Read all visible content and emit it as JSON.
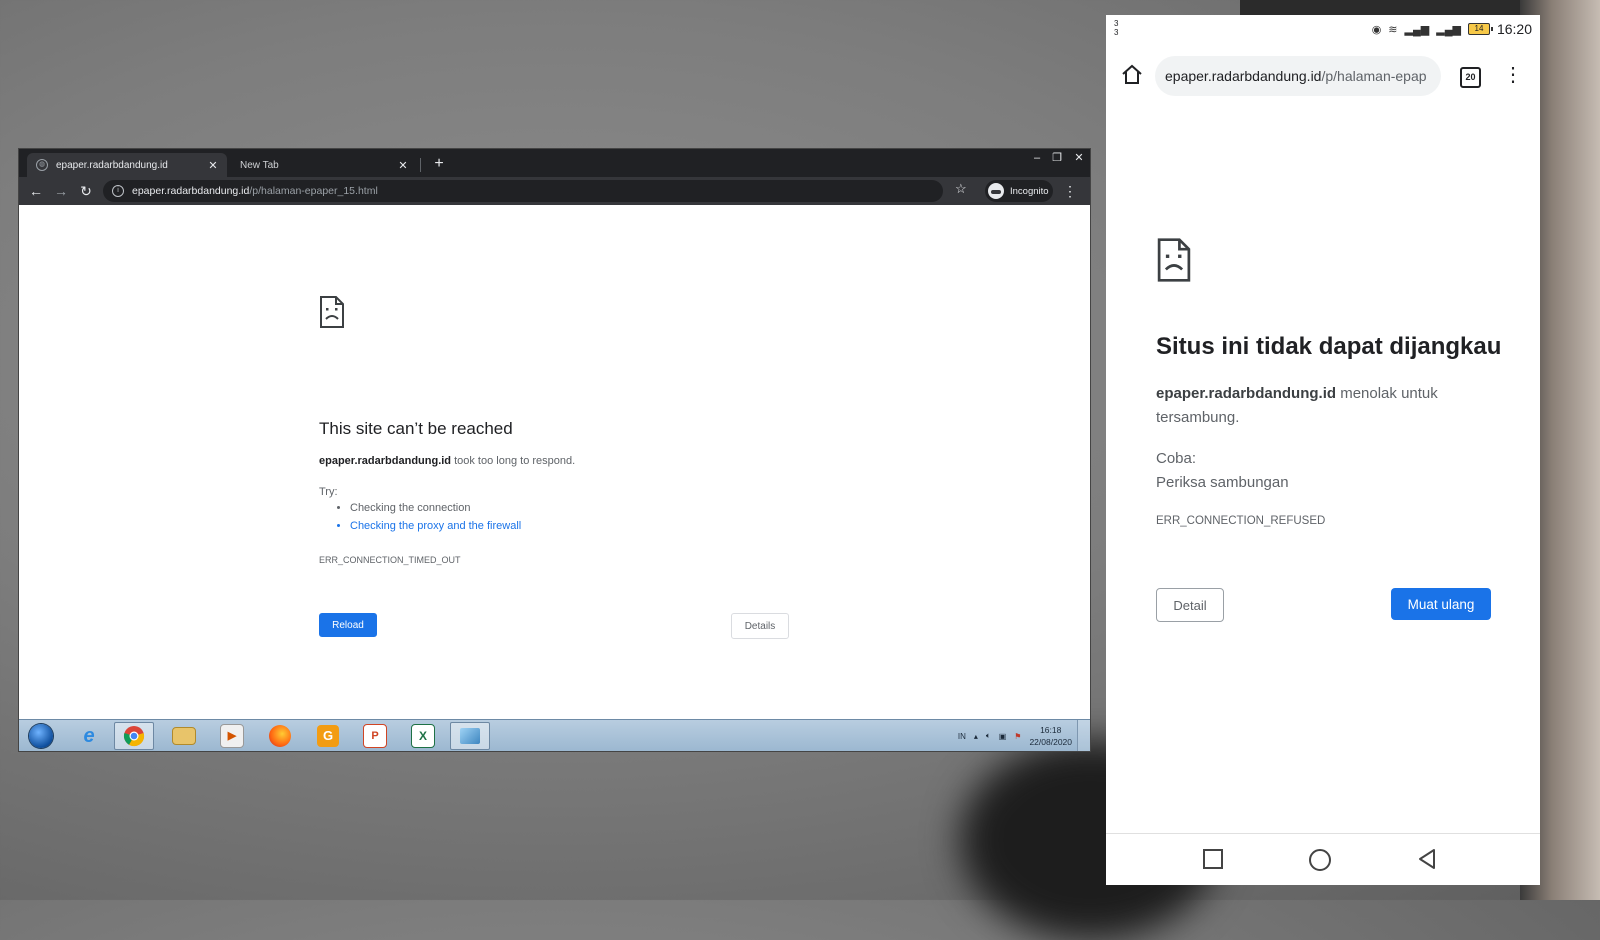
{
  "desktop": {
    "tabs": [
      {
        "label": "epaper.radarbdandung.id",
        "active": true
      },
      {
        "label": "New Tab",
        "active": false
      }
    ],
    "address": {
      "host": "epaper.radarbdandung.id",
      "path": "/p/halaman-epaper_15.html"
    },
    "incognito_label": "Incognito",
    "error": {
      "heading": "This site can’t be reached",
      "host": "epaper.radarbdandung.id",
      "message": " took too long to respond.",
      "try_label": "Try:",
      "suggestions": [
        "Checking the connection",
        "Checking the proxy and the firewall"
      ],
      "code": "ERR_CONNECTION_TIMED_OUT",
      "reload_label": "Reload",
      "details_label": "Details"
    },
    "taskbar": {
      "language": "IN",
      "time": "16:18",
      "date": "22/08/2020"
    }
  },
  "mobile": {
    "status": {
      "left_top": "3",
      "left_bottom": "3",
      "battery": "14",
      "time": "16:20"
    },
    "address": {
      "host": "epaper.radarbdandung.id",
      "path": "/p/halaman-epap"
    },
    "tab_count": "20",
    "error": {
      "heading": "Situs ini tidak dapat dijangkau",
      "host": "epaper.radarbdandung.id",
      "message": " menolak untuk tersambung.",
      "try_label": "Coba:",
      "suggestion": "Periksa sambungan",
      "code": "ERR_CONNECTION_REFUSED",
      "detail_label": "Detail",
      "reload_label": "Muat ulang"
    }
  },
  "colors": {
    "accent": "#1a73e8",
    "chrome_dark": "#35363a",
    "titlebar": "#202124"
  }
}
